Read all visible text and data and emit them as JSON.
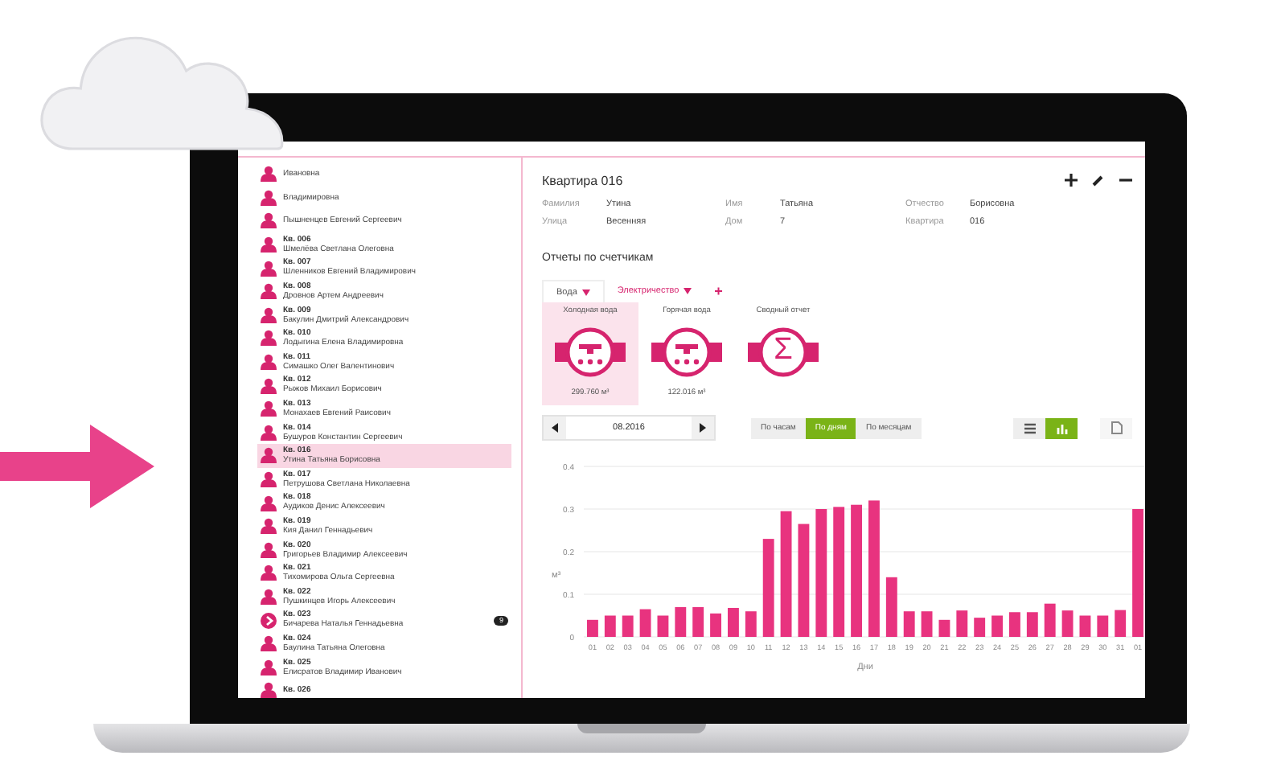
{
  "sidebar": {
    "items": [
      {
        "name": "Ивановна",
        "kind": "person",
        "selected": false
      },
      {
        "name": "Владимировна",
        "kind": "person",
        "selected": false
      },
      {
        "name": "Пышненцев Евгений Сергеевич",
        "kind": "person",
        "selected": false
      },
      {
        "label": "Кв. 006",
        "name": "Шмелёва Светлана Олеговна",
        "kind": "person",
        "selected": false
      },
      {
        "label": "Кв. 007",
        "name": "Шленников Евгений Владимирович",
        "kind": "person",
        "selected": false
      },
      {
        "label": "Кв. 008",
        "name": "Дровнов Артем Андреевич",
        "kind": "person",
        "selected": false
      },
      {
        "label": "Кв. 009",
        "name": "Бакулин Дмитрий Александрович",
        "kind": "person",
        "selected": false
      },
      {
        "label": "Кв. 010",
        "name": "Лодыгина Елена Владимировна",
        "kind": "person",
        "selected": false
      },
      {
        "label": "Кв. 011",
        "name": "Симашко Олег Валентинович",
        "kind": "person",
        "selected": false
      },
      {
        "label": "Кв. 012",
        "name": "Рыжов Михаил Борисович",
        "kind": "person",
        "selected": false
      },
      {
        "label": "Кв. 013",
        "name": "Монахаев Евгений Раисович",
        "kind": "person",
        "selected": false
      },
      {
        "label": "Кв. 014",
        "name": "Бушуров Константин Сергеевич",
        "kind": "person",
        "selected": false
      },
      {
        "label": "Кв. 016",
        "name": "Утина Татьяна Борисовна",
        "kind": "person",
        "selected": true
      },
      {
        "label": "Кв. 017",
        "name": "Петрушова Светлана Николаевна",
        "kind": "person",
        "selected": false
      },
      {
        "label": "Кв. 018",
        "name": "Аудиков Денис Алексеевич",
        "kind": "person",
        "selected": false
      },
      {
        "label": "Кв. 019",
        "name": "Кия Данил Геннадьевич",
        "kind": "person",
        "selected": false
      },
      {
        "label": "Кв. 020",
        "name": "Григорьев Владимир Алексеевич",
        "kind": "person",
        "selected": false
      },
      {
        "label": "Кв. 021",
        "name": "Тихомирова Ольга Сергеевна",
        "kind": "person",
        "selected": false
      },
      {
        "label": "Кв. 022",
        "name": "Пушкинцев Игорь Алексеевич",
        "kind": "person",
        "selected": false
      },
      {
        "label": "Кв. 023",
        "name": "Бичарева Наталья Геннадьевна",
        "kind": "arrow",
        "badge": "9",
        "selected": false
      },
      {
        "label": "Кв. 024",
        "name": "Баулина Татьяна Олеговна",
        "kind": "person",
        "selected": false
      },
      {
        "label": "Кв. 025",
        "name": "Елисратов Владимир Иванович",
        "kind": "person",
        "selected": false
      },
      {
        "label": "Кв. 026",
        "kind": "person",
        "selected": false
      }
    ]
  },
  "apartment": {
    "title": "Квартира 016",
    "fields": [
      {
        "label": "Фамилия",
        "value": "Утина"
      },
      {
        "label": "Имя",
        "value": "Татьяна"
      },
      {
        "label": "Отчество",
        "value": "Борисовна"
      },
      {
        "label": "Улица",
        "value": "Весенняя"
      },
      {
        "label": "Дом",
        "value": "7"
      },
      {
        "label": "Квартира",
        "value": "016"
      }
    ]
  },
  "reports": {
    "title": "Отчеты по счетчикам",
    "tabs": [
      {
        "label": "Вода",
        "selected": true
      },
      {
        "label": "Электричество",
        "selected": false
      }
    ],
    "add": "+",
    "meters": [
      {
        "label": "Холодная вода",
        "value": "299.760 м³",
        "kind": "water",
        "selected": true
      },
      {
        "label": "Горячая вода",
        "value": "122.016 м³",
        "kind": "water",
        "selected": false
      },
      {
        "label": "Сводный отчет",
        "kind": "summary",
        "symbol": "Σ",
        "selected": false
      }
    ],
    "period": "08.2016",
    "granularity": [
      {
        "label": "По часам",
        "selected": false
      },
      {
        "label": "По дням",
        "selected": true
      },
      {
        "label": "По месяцам",
        "selected": false
      }
    ],
    "views": [
      {
        "kind": "table",
        "selected": false
      },
      {
        "kind": "chart",
        "selected": true
      }
    ],
    "chart_data": {
      "type": "bar",
      "xlabel": "Дни",
      "ylabel": "м³",
      "categories": [
        "01",
        "02",
        "03",
        "04",
        "05",
        "06",
        "07",
        "08",
        "09",
        "10",
        "11",
        "12",
        "13",
        "14",
        "15",
        "16",
        "17",
        "18",
        "19",
        "20",
        "21",
        "22",
        "23",
        "24",
        "25",
        "26",
        "27",
        "28",
        "29",
        "30",
        "31",
        "01"
      ],
      "series": [
        {
          "color": "#e8337f",
          "values": [
            0.04,
            0.05,
            0.05,
            0.065,
            0.05,
            0.07,
            0.07,
            0.055,
            0.068,
            0.06,
            0.23,
            0.295,
            0.265,
            0.3,
            0.305,
            0.31,
            0.32,
            0.14,
            0.06,
            0.06,
            0.04,
            0.062,
            0.045,
            0.05,
            0.058,
            0.058,
            0.078,
            0.062,
            0.05,
            0.05,
            0.063,
            0.3
          ]
        }
      ],
      "ylim": [
        0,
        0.4
      ],
      "grid": true,
      "yticks": [
        0,
        0.1,
        0.2,
        0.3,
        0.4
      ]
    }
  }
}
